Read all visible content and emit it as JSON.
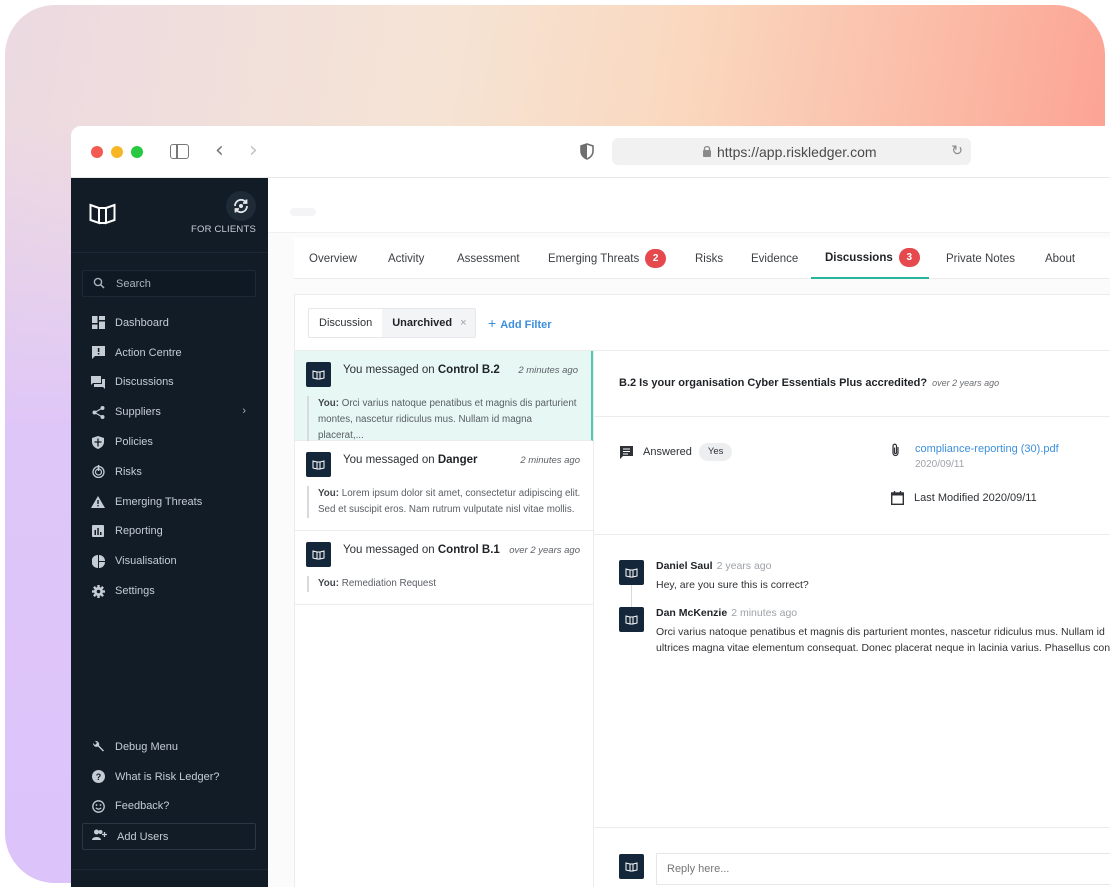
{
  "browser": {
    "url": "https://app.riskledger.com"
  },
  "sidenav": {
    "switch_label": "FOR CLIENTS",
    "search_placeholder": "Search",
    "items": [
      {
        "label": "Dashboard",
        "icon": "dashboard-icon"
      },
      {
        "label": "Action Centre",
        "icon": "action-centre-icon"
      },
      {
        "label": "Discussions",
        "icon": "discussions-icon"
      },
      {
        "label": "Suppliers",
        "icon": "share-icon",
        "has_submenu": true
      },
      {
        "label": "Policies",
        "icon": "shield-icon"
      },
      {
        "label": "Risks",
        "icon": "risks-icon"
      },
      {
        "label": "Emerging Threats",
        "icon": "warning-icon"
      },
      {
        "label": "Reporting",
        "icon": "bar-chart-icon"
      },
      {
        "label": "Visualisation",
        "icon": "pie-chart-icon"
      },
      {
        "label": "Settings",
        "icon": "gear-icon"
      }
    ],
    "bottom_items": [
      {
        "label": "Debug Menu",
        "icon": "wrench-icon"
      },
      {
        "label": "What is Risk Ledger?",
        "icon": "help-icon"
      },
      {
        "label": "Feedback?",
        "icon": "smiley-icon"
      }
    ],
    "add_users_label": "Add Users"
  },
  "tabs": [
    {
      "label": "Overview"
    },
    {
      "label": "Activity"
    },
    {
      "label": "Assessment"
    },
    {
      "label": "Emerging Threats",
      "badge": "2"
    },
    {
      "label": "Risks"
    },
    {
      "label": "Evidence"
    },
    {
      "label": "Discussions",
      "badge": "3",
      "active": true
    },
    {
      "label": "Private Notes"
    },
    {
      "label": "About"
    }
  ],
  "filters": {
    "key": "Discussion",
    "value": "Unarchived",
    "remove": "×",
    "add_label": "Add Filter"
  },
  "threads": [
    {
      "prefix": "You messaged on",
      "subject": "Control B.2",
      "time": "2 minutes ago",
      "author": "You:",
      "preview_lines": [
        "Orci varius natoque penatibus et magnis dis parturient",
        "montes, nascetur ridiculus mus. Nullam id magna placerat,..."
      ],
      "selected": true
    },
    {
      "prefix": "You messaged on",
      "subject": "Danger",
      "time": "2 minutes ago",
      "author": "You:",
      "preview_lines": [
        "Lorem ipsum dolor sit amet, consectetur adipiscing elit.",
        "Sed et suscipit eros. Nam rutrum vulputate nisl vitae mollis."
      ]
    },
    {
      "prefix": "You messaged on",
      "subject": "Control B.1",
      "time": "over 2 years ago",
      "author": "You:",
      "preview_lines": [
        "Remediation Request"
      ]
    }
  ],
  "detail": {
    "question": "B.2 Is your organisation Cyber Essentials Plus accredited?",
    "question_time": "over 2 years ago",
    "answered_label": "Answered",
    "answered_value": "Yes",
    "attachment_name": "compliance-reporting (30).pdf",
    "attachment_date": "2020/09/11",
    "last_modified": "Last Modified 2020/09/11",
    "messages": [
      {
        "author": "Daniel Saul",
        "time": "2 years ago",
        "lines": [
          "Hey, are you sure this is correct?"
        ]
      },
      {
        "author": "Dan McKenzie",
        "time": "2 minutes ago",
        "lines": [
          "Orci varius natoque penatibus et magnis dis parturient montes, nascetur ridiculus mus. Nullam id",
          "ultrices magna vitae elementum consequat. Donec placerat neque in lacinia varius. Phasellus con"
        ]
      }
    ],
    "reply_placeholder": "Reply here..."
  },
  "colors": {
    "accent": "#27b59c",
    "badge": "#e5484d",
    "link": "#3b8fdd",
    "sidebar": "#111c27",
    "avatar": "#14273a"
  }
}
